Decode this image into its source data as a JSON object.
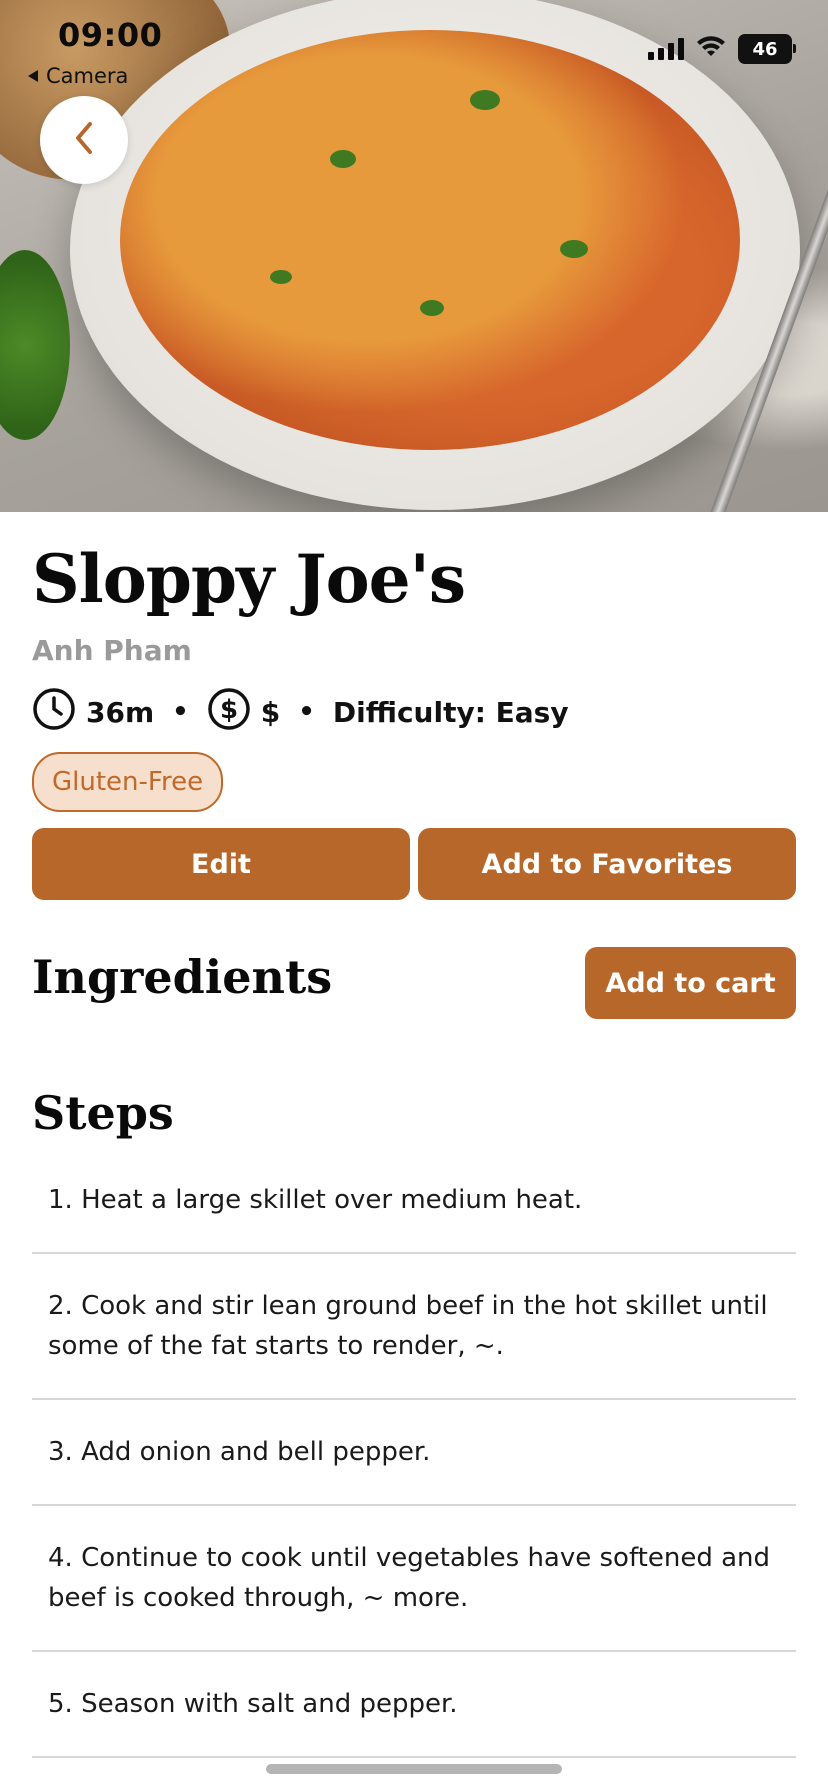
{
  "status_bar": {
    "time": "09:00",
    "back_app": "Camera",
    "battery": "46"
  },
  "hero": {
    "image_icon": "pasta-photo"
  },
  "recipe": {
    "title": "Sloppy Joe's",
    "author": "Anh Pham",
    "time": "36m",
    "cost": "$",
    "difficulty": "Difficulty: Easy",
    "tags": [
      "Gluten-Free"
    ]
  },
  "actions": {
    "edit_label": "Edit",
    "favorites_label": "Add to Favorites"
  },
  "ingredients": {
    "title": "Ingredients",
    "add_to_cart_label": "Add to cart"
  },
  "steps": {
    "title": "Steps",
    "items": [
      "1. Heat a large skillet over medium heat.",
      "2. Cook and stir lean ground beef in the hot skillet until some of the fat starts to render, ~.",
      "3. Add onion and bell pepper.",
      "4. Continue to cook until vegetables have softened and beef is cooked through, ~ more.",
      "5. Season with salt and pepper."
    ]
  },
  "colors": {
    "accent": "#b8672a",
    "tag_bg": "#f6dfcc",
    "tag_text": "#c0692a"
  }
}
